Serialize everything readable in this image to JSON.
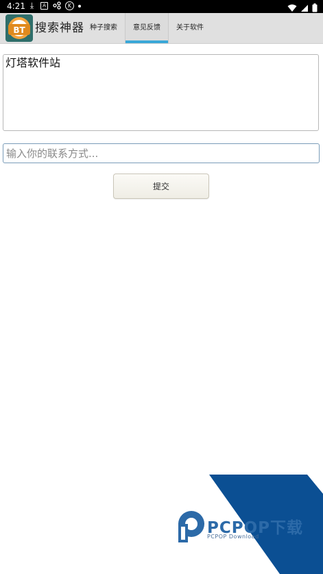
{
  "status_bar": {
    "time": "4:21",
    "icons": [
      "download-icon",
      "a-box-icon",
      "share-icon",
      "k-circle-icon",
      "dot-icon",
      "wifi-icon",
      "signal-icon",
      "battery-icon"
    ]
  },
  "header": {
    "app_title": "搜索神器",
    "logo_text": "BT",
    "tabs": [
      {
        "label": "种子搜索"
      },
      {
        "label": "意见反馈"
      },
      {
        "label": "关于软件"
      }
    ],
    "active_tab": "意见反馈",
    "accent_color": "#3aa8d8"
  },
  "form": {
    "feedback_text": "灯塔软件站",
    "contact_placeholder": "输入你的联系方式...",
    "contact_value": "",
    "submit_label": "提交"
  },
  "watermark": {
    "brand": "PCPOP下载",
    "sub": "PCPOP Download",
    "color": "#0b4f93"
  }
}
